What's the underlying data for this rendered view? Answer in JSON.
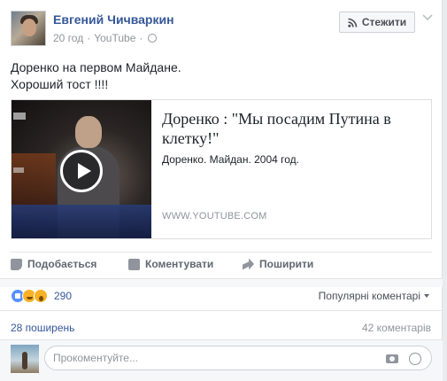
{
  "post": {
    "author": "Евгений Чичваркин",
    "time": "20 год",
    "source": "YouTube",
    "separator": "·",
    "follow_label": "Стежити",
    "text_line1": "Доренко на первом Майдане.",
    "text_line2": "Хороший тост !!!!"
  },
  "preview": {
    "title": "Доренко : \"Мы посадим Путина в клетку!\"",
    "description": "Доренко. Майдан. 2004 год.",
    "domain": "WWW.YOUTUBE.COM"
  },
  "actions": {
    "like": "Подобається",
    "comment": "Коментувати",
    "share": "Поширити"
  },
  "stats": {
    "reaction_count": "290",
    "reactions": [
      "like",
      "haha",
      "wow"
    ],
    "sort_label": "Популярні коментарі",
    "shares": "28 поширень",
    "comments": "42 коментарів"
  },
  "composer": {
    "placeholder": "Прокоментуйте..."
  },
  "colors": {
    "link_blue": "#365899",
    "muted": "#90949c",
    "like_blue": "#5890ff",
    "emoji_yellow": "#f7b125"
  }
}
